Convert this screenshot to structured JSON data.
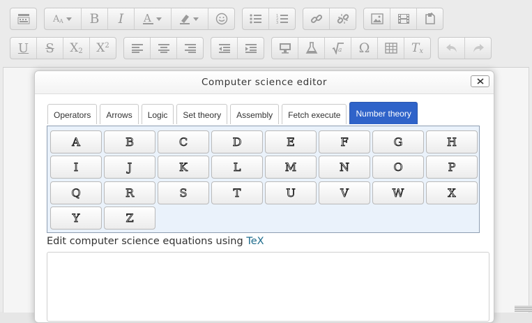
{
  "toolbar": {
    "row1": [
      {
        "icon": "collapse-icon"
      },
      {
        "icon": "font-size-icon"
      },
      {
        "icon": "bold-icon",
        "text": "B"
      },
      {
        "icon": "italic-icon",
        "text": "I"
      },
      {
        "icon": "text-color-icon"
      },
      {
        "icon": "background-color-icon"
      },
      {
        "icon": "emoji-icon"
      },
      {
        "icon": "bulleted-list-icon"
      },
      {
        "icon": "numbered-list-icon"
      },
      {
        "icon": "link-icon"
      },
      {
        "icon": "unlink-icon"
      },
      {
        "icon": "image-icon"
      },
      {
        "icon": "media-icon"
      },
      {
        "icon": "manage-files-icon"
      }
    ],
    "row2": [
      {
        "icon": "underline-icon",
        "text": "U"
      },
      {
        "icon": "strikethrough-icon",
        "text": "S"
      },
      {
        "icon": "subscript-icon",
        "text": "X2"
      },
      {
        "icon": "superscript-icon",
        "text": "X2"
      },
      {
        "icon": "align-left-icon"
      },
      {
        "icon": "align-center-icon"
      },
      {
        "icon": "align-right-icon"
      },
      {
        "icon": "outdent-icon"
      },
      {
        "icon": "indent-icon"
      },
      {
        "icon": "computer-science-icon"
      },
      {
        "icon": "chemistry-icon"
      },
      {
        "icon": "equation-icon"
      },
      {
        "icon": "special-character-icon",
        "text": "Ω"
      },
      {
        "icon": "table-icon"
      },
      {
        "icon": "clear-formatting-icon",
        "text": "Tx"
      },
      {
        "icon": "undo-icon"
      },
      {
        "icon": "redo-icon"
      }
    ]
  },
  "dialog": {
    "title": "Computer science editor",
    "close_icon": "close-icon",
    "tabs": [
      "Operators",
      "Arrows",
      "Logic",
      "Set theory",
      "Assembly",
      "Fetch execute",
      "Number theory"
    ],
    "active_tab": "Number theory",
    "keys": [
      "A",
      "B",
      "C",
      "D",
      "E",
      "F",
      "G",
      "H",
      "I",
      "J",
      "K",
      "L",
      "M",
      "N",
      "O",
      "P",
      "Q",
      "R",
      "S",
      "T",
      "U",
      "V",
      "W",
      "X",
      "Y",
      "Z"
    ],
    "help_prefix": "Edit computer science equations using ",
    "help_link": "TeX",
    "tex_value": ""
  },
  "colors": {
    "active_tab": "#2f63c9",
    "keypad_bg": "#eaf2fb",
    "link": "#1d6b8c"
  }
}
